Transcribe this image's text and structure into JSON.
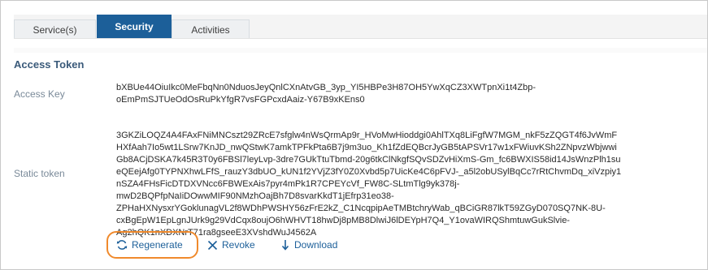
{
  "tabs": [
    {
      "label": "Service(s)"
    },
    {
      "label": "Security"
    },
    {
      "label": "Activities"
    }
  ],
  "section": {
    "title": "Access Token"
  },
  "access_key": {
    "label": "Access Key",
    "lines": [
      "bXBUe44OiuIkc0MeFbqNn0NduosJeyQnlCXnAtvGB_3yp_YI5HBPe3H87OH5YwXqCZ3XWTpnXi1t4Zbp-",
      "oEmPmSJTUeOdOsRuPkYfgR7vsFGPcxdAaiz-Y67B9xKEns0"
    ]
  },
  "static_token": {
    "label": "Static token",
    "lines": [
      "3GKZiLOQZ4A4FAxFNiMNCszt29ZRcE7sfglw4nWsQrmAp9r_HVoMwHioddgi0AhlTXq8LiFgfW7MGM_nkF5zZQGT4f6JvWmF",
      "HXfAah7Io5wt1LSrw7KnJD_nwQStwK7amkTPFkPta6B7j9m3uo_Kh1fZdEQBcrJyGB5tAPSVr17w1xFWiuvKSh2ZNpvzWbjwwi",
      "Gb8ACjDSKA7k45R3T0y6FBSl7leyLvp-3dre7GUkTtuTbmd-20g6tkClNkgfSQvSDZvHiXmS-Gm_fc6BWXIS58id14JsWnzPlh1su",
      "eQEejAfg0TYPNXhwLFfS_rauzY3dbUO_kUN1f2YVjZ3fY0Z0Xvbd5p7UicKe4C6pFVJ-_a5l2obUSylBqCc7rRtChvmDq_xiVzpiy1",
      "nSZA4FHsFicDTDXVNcc6FBWExAis7pyr4mPk1R7CPEYcVf_FW8C-SLtmTlg9yk378j-",
      "mwD2BQPfpNaIiDOwwMIF90NMzhOajBh7D8svarKkdT1jEfrp31eo38-",
      "ZPHaHXNysxrYGoklunagVL2f8WDhPWSHY56zFrE2kZ_C1NcqpipAeTMBtchryWab_qBCiGR87lkT59ZGyD070SQ7NK-8U-",
      "cxBgEpW1EpLgnJUrk9g29VdCqx8oujO6hWHVT18hwDj8pMB8DlwiJ6lDEYpH7Q4_Y1ovaWIRQShmtuwGukSlvie-",
      "Ag2hQK1nXDXNrT71ra8gseeE3XVshdWuJ4562A"
    ]
  },
  "actions": {
    "regenerate": "Regenerate",
    "revoke": "Revoke",
    "download": "Download"
  },
  "colors": {
    "tab_active_bg": "#1c5f99",
    "link": "#1c5f99",
    "highlight": "#f08a2c"
  }
}
